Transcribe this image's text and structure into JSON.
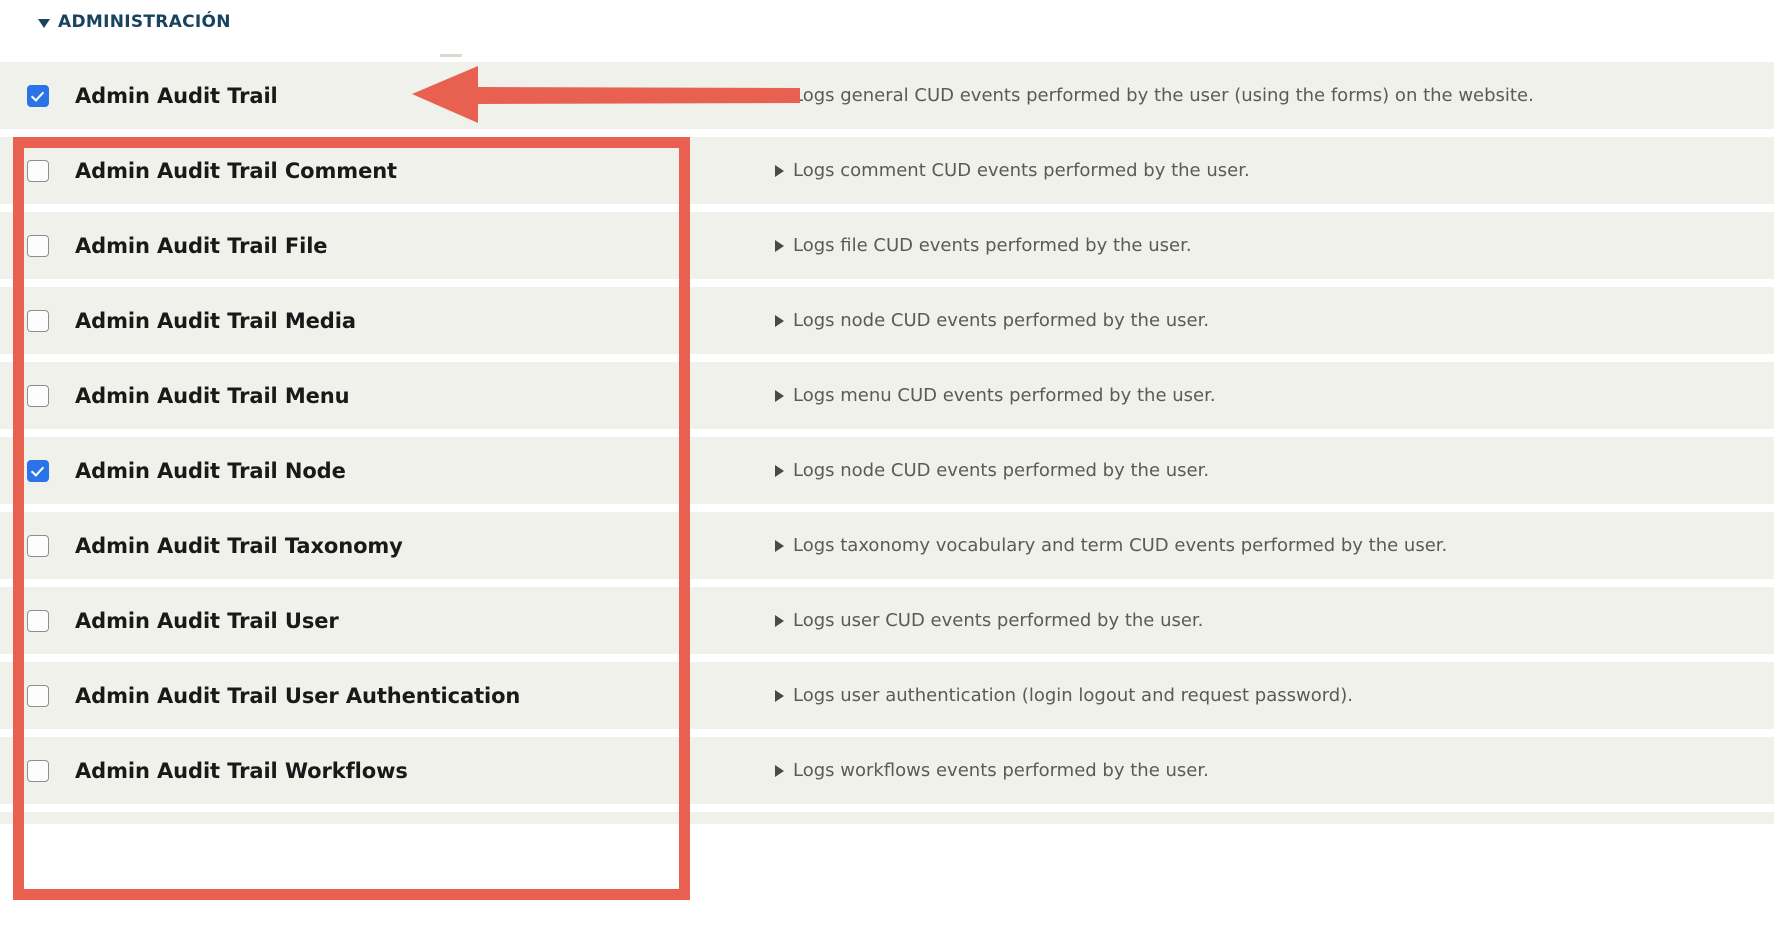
{
  "section": {
    "title": "ADMINISTRACIÓN",
    "collapse_icon": "triangle-down-icon",
    "color": "#17435e"
  },
  "colors": {
    "annotation_red": "#e8604f",
    "checkbox_blue": "#2b73e8",
    "row_background": "#f1f1ec",
    "page_background": "#ffffff",
    "description_text": "#5b5b55",
    "module_name_text": "#191919"
  },
  "modules": [
    {
      "name": "Admin Audit Trail",
      "checked": true,
      "description": "Logs general CUD events performed by the user (using the forms) on the website."
    },
    {
      "name": "Admin Audit Trail Comment",
      "checked": false,
      "description": "Logs comment CUD events performed by the user."
    },
    {
      "name": "Admin Audit Trail File",
      "checked": false,
      "description": "Logs file CUD events performed by the user."
    },
    {
      "name": "Admin Audit Trail Media",
      "checked": false,
      "description": "Logs node CUD events performed by the user."
    },
    {
      "name": "Admin Audit Trail Menu",
      "checked": false,
      "description": "Logs menu CUD events performed by the user."
    },
    {
      "name": "Admin Audit Trail Node",
      "checked": true,
      "description": "Logs node CUD events performed by the user."
    },
    {
      "name": "Admin Audit Trail Taxonomy",
      "checked": false,
      "description": "Logs taxonomy vocabulary and term CUD events performed by the user."
    },
    {
      "name": "Admin Audit Trail User",
      "checked": false,
      "description": "Logs user CUD events performed by the user."
    },
    {
      "name": "Admin Audit Trail User Authentication",
      "checked": false,
      "description": "Logs user authentication (login logout and request password)."
    },
    {
      "name": "Admin Audit Trail Workflows",
      "checked": false,
      "description": "Logs workflows events performed by the user."
    }
  ],
  "annotations": {
    "arrow": {
      "shape": "left-pointing-arrow",
      "color": "#e8604f",
      "points_to": "Admin Audit Trail"
    },
    "box": {
      "shape": "rectangle-outline",
      "color": "#e8604f",
      "encloses": "Admin Audit Trail Comment through Admin Audit Trail Workflows"
    }
  }
}
